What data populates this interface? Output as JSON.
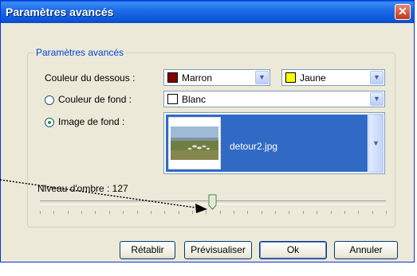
{
  "window": {
    "title": "Paramètres avancés",
    "close_symbol": "✕"
  },
  "group": {
    "legend": "Paramètres avancés"
  },
  "under_color": {
    "label": "Couleur du dessous :",
    "primary": {
      "text": "Marron",
      "color": "#800000"
    },
    "secondary": {
      "text": "Jaune",
      "color": "#ffff00"
    }
  },
  "background_color": {
    "label": "Couleur de fond :",
    "selected": false,
    "value": "Blanc",
    "color": "#ffffff"
  },
  "background_image": {
    "label": "Image de fond :",
    "selected": true,
    "value": "detour2.jpg"
  },
  "shadow": {
    "label": "Niveau d'ombre : 127",
    "value": 127,
    "max": 255
  },
  "buttons": {
    "reset": "Rétablir",
    "preview": "Prévisualiser",
    "ok": "Ok",
    "cancel": "Annuler"
  },
  "colors": {
    "title_bar": "#0a5fe3",
    "selection": "#316ac5",
    "dialog_bg": "#ece9d8",
    "legend_text": "#0046d5"
  }
}
